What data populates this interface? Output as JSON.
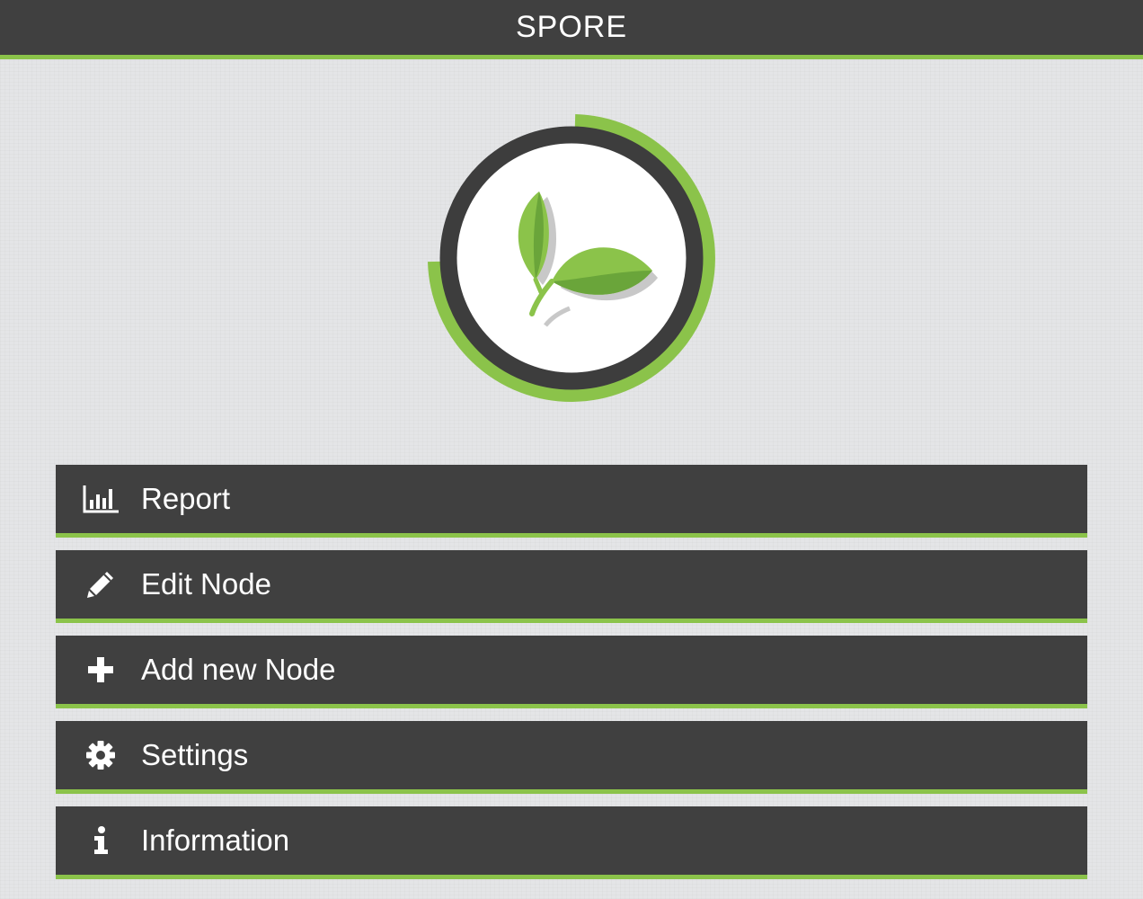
{
  "app": {
    "title": "SPORE"
  },
  "colors": {
    "accent": "#8bc34a",
    "bar": "#404040",
    "background": "#e4e5e7"
  },
  "logo": {
    "icon": "leaves-icon"
  },
  "menu": {
    "items": [
      {
        "label": "Report",
        "icon": "bar-chart-icon"
      },
      {
        "label": "Edit Node",
        "icon": "pencil-icon"
      },
      {
        "label": "Add new Node",
        "icon": "plus-icon"
      },
      {
        "label": "Settings",
        "icon": "gear-icon"
      },
      {
        "label": "Information",
        "icon": "info-icon"
      }
    ]
  }
}
